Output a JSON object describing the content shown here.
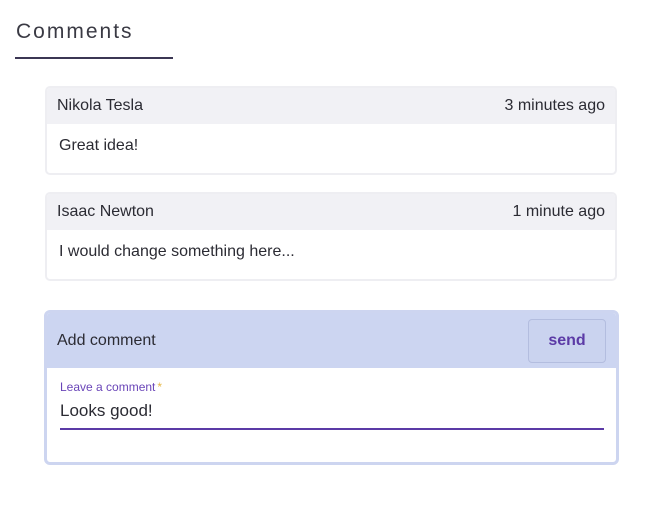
{
  "section": {
    "title": "Comments"
  },
  "comments": [
    {
      "author": "Nikola Tesla",
      "time": "3 minutes ago",
      "text": "Great idea!"
    },
    {
      "author": "Isaac Newton",
      "time": "1 minute ago",
      "text": "I would change something here..."
    }
  ],
  "add_comment": {
    "title": "Add comment",
    "send_label": "send",
    "field_label": "Leave a comment",
    "required_mark": "*",
    "value": "Looks good!"
  },
  "colors": {
    "accent": "#5b3aa6",
    "header_bg": "#ccd5f1",
    "required": "#e6b84a"
  }
}
